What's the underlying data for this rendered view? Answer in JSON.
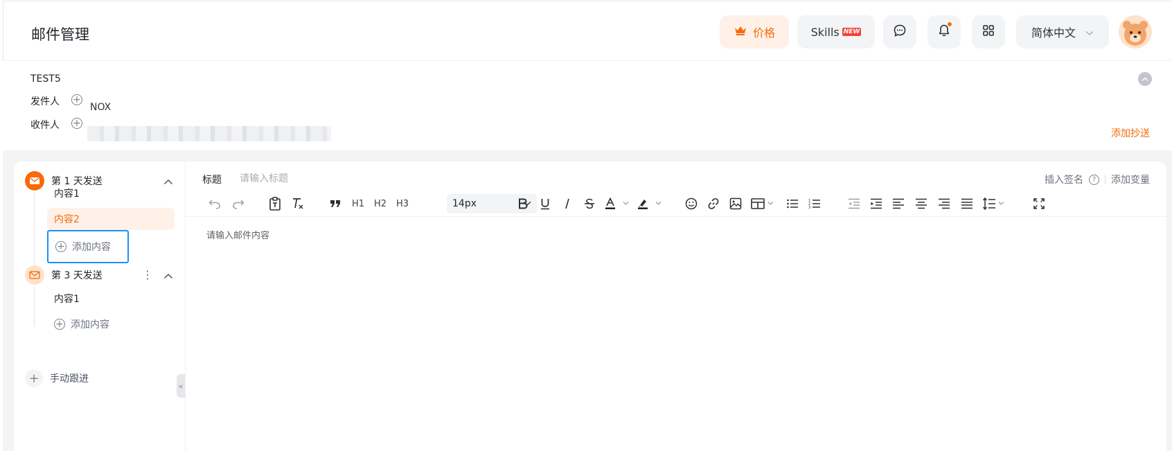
{
  "header": {
    "title": "邮件管理",
    "price_label": "价格",
    "skills_label": "Skills",
    "skills_badge": "NEW",
    "language": "简体中文"
  },
  "mail": {
    "name": "TEST5",
    "sender_label": "发件人",
    "sender_value": "NOX",
    "recipient_label": "收件人",
    "add_cc": "添加抄送"
  },
  "sequence": {
    "days": [
      {
        "label": "第 1 天发送",
        "items": [
          "内容1",
          "内容2"
        ],
        "active_item": 1,
        "add_label": "添加内容"
      },
      {
        "label": "第 3 天发送",
        "items": [
          "内容1"
        ],
        "add_label": "添加内容"
      }
    ],
    "manual_followup": "手动跟进"
  },
  "editor": {
    "subject_label": "标题",
    "subject_placeholder": "请输入标题",
    "insert_signature": "插入签名",
    "add_variable": "添加变量",
    "font_size": "14px",
    "heading_labels": [
      "H1",
      "H2",
      "H3"
    ],
    "body_placeholder": "请输入邮件内容"
  },
  "colors": {
    "accent": "#f56a0a",
    "focus": "#1890ff"
  }
}
